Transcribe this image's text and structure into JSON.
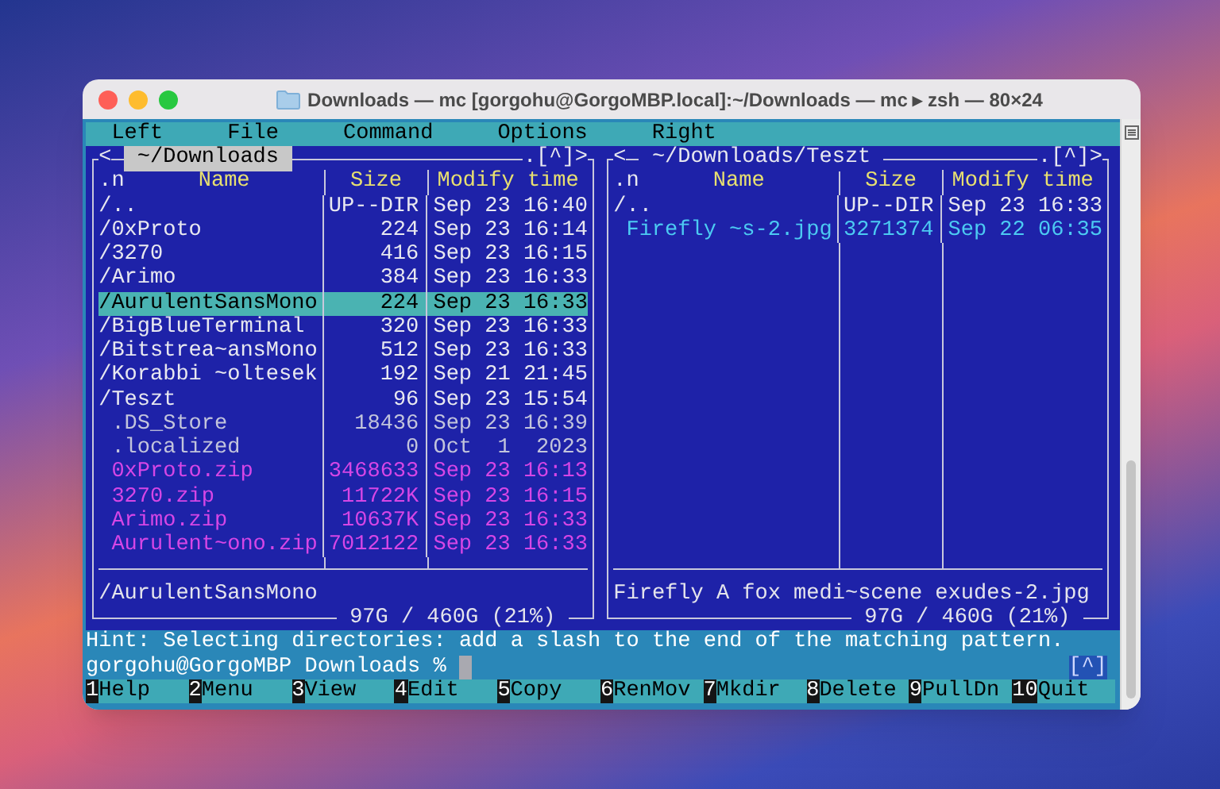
{
  "window": {
    "title": "Downloads — mc [gorgohu@GorgoMBP.local]:~/Downloads — mc ▸ zsh — 80×24"
  },
  "menu_bar": [
    "Left",
    "File",
    "Command",
    "Options",
    "Right"
  ],
  "panels": [
    {
      "active": true,
      "nav_left": "<",
      "path": "~/Downloads",
      "nav_right": ".[^]>",
      "sort_indicator": ".n",
      "columns": [
        "Name",
        "Size",
        "Modify time"
      ],
      "files": [
        {
          "name": "/..",
          "size": "UP--DIR",
          "time": "Sep 23 16:40",
          "kind": "updir",
          "selected": false
        },
        {
          "name": "/0xProto",
          "size": "224",
          "time": "Sep 23 16:14",
          "kind": "dir",
          "selected": false
        },
        {
          "name": "/3270",
          "size": "416",
          "time": "Sep 23 16:15",
          "kind": "dir",
          "selected": false
        },
        {
          "name": "/Arimo",
          "size": "384",
          "time": "Sep 23 16:33",
          "kind": "dir",
          "selected": false
        },
        {
          "name": "/AurulentSansMono",
          "size": "224",
          "time": "Sep 23 16:33",
          "kind": "dir",
          "selected": true
        },
        {
          "name": "/BigBlueTerminal",
          "size": "320",
          "time": "Sep 23 16:33",
          "kind": "dir",
          "selected": false
        },
        {
          "name": "/Bitstrea~ansMono",
          "size": "512",
          "time": "Sep 23 16:33",
          "kind": "dir",
          "selected": false
        },
        {
          "name": "/Korabbi ~oltesek",
          "size": "192",
          "time": "Sep 21 21:45",
          "kind": "dir",
          "selected": false
        },
        {
          "name": "/Teszt",
          "size": "96",
          "time": "Sep 23 15:54",
          "kind": "dir",
          "selected": false
        },
        {
          "name": ".DS_Store",
          "size": "18436",
          "time": "Sep 23 16:39",
          "kind": "hidden",
          "selected": false
        },
        {
          "name": ".localized",
          "size": "0",
          "time": "Oct  1  2023",
          "kind": "hidden",
          "selected": false
        },
        {
          "name": "0xProto.zip",
          "size": "3468633",
          "time": "Sep 23 16:13",
          "kind": "archive",
          "selected": false
        },
        {
          "name": "3270.zip",
          "size": "11722K",
          "time": "Sep 23 16:15",
          "kind": "archive",
          "selected": false
        },
        {
          "name": "Arimo.zip",
          "size": "10637K",
          "time": "Sep 23 16:33",
          "kind": "archive",
          "selected": false
        },
        {
          "name": "Aurulent~ono.zip",
          "size": "7012122",
          "time": "Sep 23 16:33",
          "kind": "archive",
          "selected": false
        }
      ],
      "mini_status": "/AurulentSansMono",
      "disk_usage": "97G / 460G (21%)"
    },
    {
      "active": false,
      "nav_left": "<",
      "path": "~/Downloads/Teszt",
      "nav_right": ".[^]>",
      "sort_indicator": ".n",
      "columns": [
        "Name",
        "Size",
        "Modify time"
      ],
      "files": [
        {
          "name": "/..",
          "size": "UP--DIR",
          "time": "Sep 23 16:33",
          "kind": "updir",
          "selected": false
        },
        {
          "name": "Firefly ~s-2.jpg",
          "size": "3271374",
          "time": "Sep 22 06:35",
          "kind": "image",
          "selected": false
        }
      ],
      "mini_status": "Firefly A fox medi~scene exudes-2.jpg",
      "disk_usage": "97G / 460G (21%)"
    }
  ],
  "hint": "Hint: Selecting directories: add a slash to the end of the matching pattern.",
  "prompt": "gorgohu@GorgoMBP Downloads %",
  "prompt_indicator": "[^]",
  "function_keys": [
    {
      "number": "1",
      "label": "Help"
    },
    {
      "number": "2",
      "label": "Menu"
    },
    {
      "number": "3",
      "label": "View"
    },
    {
      "number": "4",
      "label": "Edit"
    },
    {
      "number": "5",
      "label": "Copy"
    },
    {
      "number": "6",
      "label": "RenMov"
    },
    {
      "number": "7",
      "label": "Mkdir"
    },
    {
      "number": "8",
      "label": "Delete"
    },
    {
      "number": "9",
      "label": "PullDn"
    },
    {
      "number": "10",
      "label": "Quit"
    }
  ]
}
